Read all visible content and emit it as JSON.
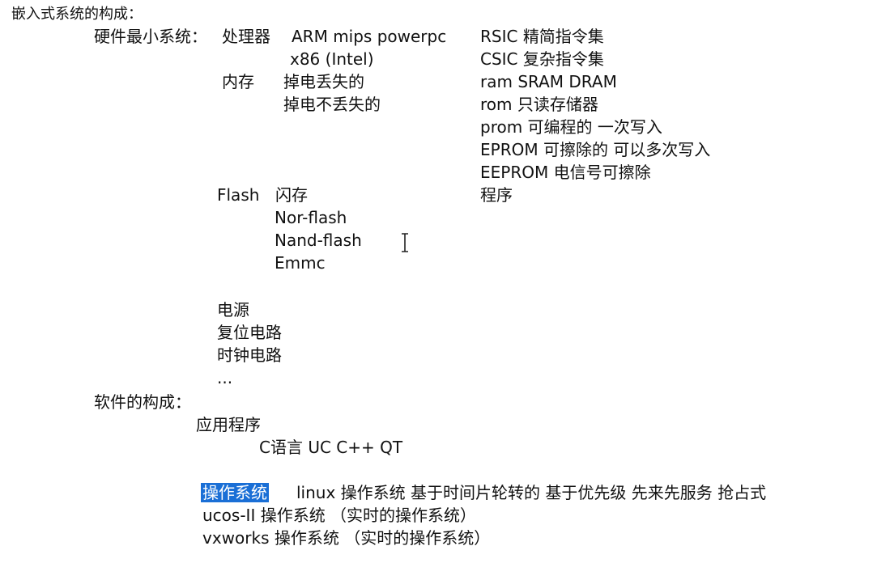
{
  "title": "嵌入式系统的构成：",
  "hardware": {
    "label": "硬件最小系统：",
    "processor": {
      "label": "处理器",
      "row1": "ARM  mips  powerpc",
      "row2": "x86 (Intel)",
      "risc": "RSIC 精简指令集",
      "cisc": "CSIC 复杂指令集"
    },
    "memory": {
      "label": "内存",
      "volatile": "掉电丢失的",
      "nonvolatile": "掉电不丢失的",
      "ram": "ram  SRAM    DRAM",
      "rom": "rom  只读存储器",
      "prom": "prom  可编程的 一次写入",
      "eprom": "EPROM 可擦除的 可以多次写入",
      "eeprom": "EEPROM 电信号可擦除",
      "program": "程序"
    },
    "flash": {
      "label": "Flash",
      "desc": "闪存",
      "items": [
        "Nor-flash",
        "Nand-flash",
        "Emmc"
      ]
    },
    "other": [
      "电源",
      "复位电路",
      "时钟电路",
      "..."
    ]
  },
  "software": {
    "label": "软件的构成：",
    "apps": {
      "label": "应用程序",
      "langs": "C语言   UC    C++    QT"
    },
    "os": {
      "label": "操作系统",
      "line1_rest": "linux 操作系统    基于时间片轮转的  基于优先级  先来先服务  抢占式",
      "line2": "ucos-II  操作系统 （实时的操作系统）",
      "line3": "vxworks  操作系统 （实时的操作系统）"
    }
  }
}
